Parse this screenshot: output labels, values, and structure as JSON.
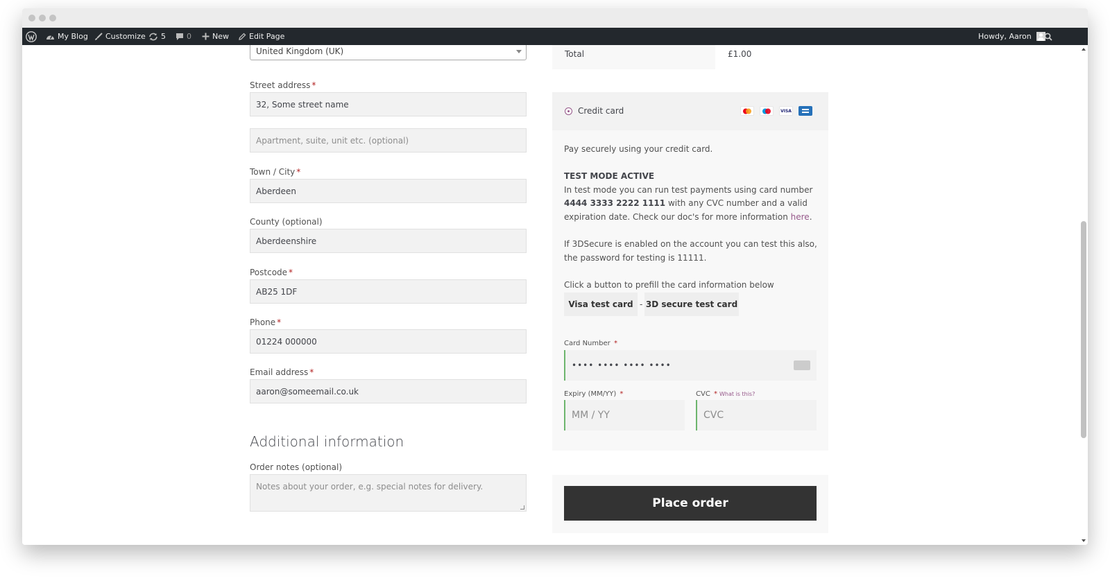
{
  "adminbar": {
    "site_name": "My Blog",
    "customize": "Customize",
    "updates_count": "5",
    "comments_count": "0",
    "new_label": "New",
    "edit_page": "Edit Page",
    "howdy": "Howdy, Aaron"
  },
  "billing": {
    "country_value": "United Kingdom (UK)",
    "street_label": "Street address",
    "street_value": "32, Some street name",
    "apartment_placeholder": "Apartment, suite, unit etc. (optional)",
    "city_label": "Town / City",
    "city_value": "Aberdeen",
    "county_label": "County (optional)",
    "county_value": "Aberdeenshire",
    "postcode_label": "Postcode",
    "postcode_value": "AB25 1DF",
    "phone_label": "Phone",
    "phone_value": "01224 000000",
    "email_label": "Email address",
    "email_value": "aaron@someemail.co.uk",
    "required_mark": "*"
  },
  "additional": {
    "heading": "Additional information",
    "notes_label": "Order notes (optional)",
    "notes_placeholder": "Notes about your order, e.g. special notes for delivery."
  },
  "order": {
    "total_label": "Total",
    "total_value": "£1.00"
  },
  "payment": {
    "method_title": "Credit card",
    "card_icons": [
      "mastercard-icon",
      "maestro-icon",
      "visa-icon",
      "amex-icon"
    ],
    "visa_text": "VISA",
    "desc": "Pay securely using your credit card.",
    "test_mode_title": "TEST MODE ACTIVE",
    "test_text_1": "In test mode you can run test payments using card number ",
    "test_card_number": "4444 3333 2222 1111",
    "test_text_2": " with any CVC number and a valid expiration date. Check our doc's for more information ",
    "here_link": "here",
    "period": ".",
    "secure_text": "If 3DSecure is enabled on the account you can test this also, the password for testing is 11111.",
    "prefill_text": "Click a button to prefill the card information below",
    "visa_test_button": "Visa test card",
    "separator": "-",
    "secure_test_button": "3D secure test card",
    "card_number_label": "Card Number",
    "card_number_value": "•••• •••• •••• ••••",
    "expiry_label": "Expiry (MM/YY)",
    "expiry_placeholder": "MM / YY",
    "cvc_label": "CVC",
    "cvc_what": "What is this?",
    "cvc_placeholder": "CVC",
    "required_mark": "*"
  },
  "place_order": "Place order",
  "colors": {
    "adminbar_bg": "#23282d",
    "accent": "#96588a",
    "button_dark": "#333333",
    "focus_green": "#6db56d"
  }
}
